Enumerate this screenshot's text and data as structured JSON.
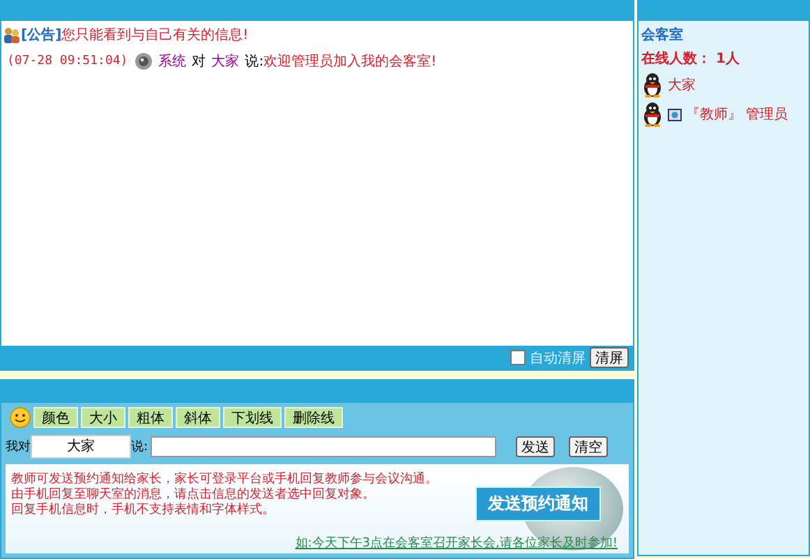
{
  "announcement": {
    "tag": "[公告]",
    "text": "您只能看到与自己有关的信息!"
  },
  "messages": [
    {
      "time": "(07-28 09:51:04)",
      "sender": "系统",
      "to_word": "对",
      "recipient": "大家",
      "says": "说:",
      "text": "欢迎管理员加入我的会客室!"
    }
  ],
  "chat_footer": {
    "auto_clear": {
      "label": "自动清屏",
      "checked": false
    },
    "clear_button": "清屏"
  },
  "format_buttons": [
    "颜色",
    "大小",
    "粗体",
    "斜体",
    "下划线",
    "删除线"
  ],
  "compose": {
    "me_to": "我对",
    "recipient": "大家",
    "says": "说:",
    "send_button": "发送",
    "clear_button": "清空"
  },
  "notice_lines": [
    "教师可发送预约通知给家长，家长可登录平台或手机回复教师参与会议沟通。",
    "由手机回复至聊天室的消息，请点击信息的发送者选中回复对象。",
    "回复手机信息时，手机不支持表情和字体样式。"
  ],
  "notify_button": "发送预约通知",
  "example_link": "如:今天下午3点在会客室召开家长会,请各位家长及时参加!",
  "sidebar": {
    "title": "会客室",
    "online_count": "在线人数： 1人",
    "users": [
      {
        "name": "大家",
        "kind": "group"
      },
      {
        "name": "『教师』 管理员",
        "kind": "teacher"
      }
    ]
  }
}
